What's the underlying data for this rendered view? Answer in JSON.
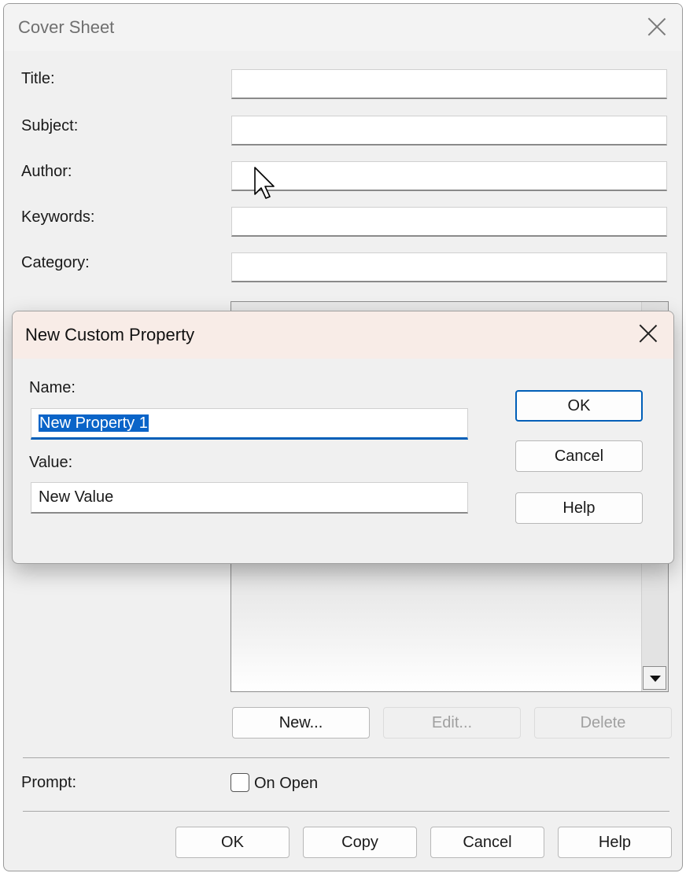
{
  "cover_sheet": {
    "title": "Cover Sheet",
    "fields": {
      "title_label": "Title:",
      "subject_label": "Subject:",
      "author_label": "Author:",
      "keywords_label": "Keywords:",
      "category_label": "Category:"
    },
    "property_buttons": {
      "new_label": "New...",
      "edit_label": "Edit...",
      "delete_label": "Delete"
    },
    "prompt": {
      "label": "Prompt:",
      "on_open_label": "On Open",
      "on_open_checked": false
    },
    "footer": {
      "ok_label": "OK",
      "copy_label": "Copy",
      "cancel_label": "Cancel",
      "help_label": "Help"
    }
  },
  "new_custom_property": {
    "title": "New Custom Property",
    "name_label": "Name:",
    "name_value": "New Property 1",
    "value_label": "Value:",
    "value_value": "New Value",
    "ok_label": "OK",
    "cancel_label": "Cancel",
    "help_label": "Help"
  },
  "colors": {
    "accent": "#005fb8",
    "selection": "#0a64c8",
    "dialog_bg": "#f0f0f0",
    "active_titlebar": "#f8ece7"
  }
}
